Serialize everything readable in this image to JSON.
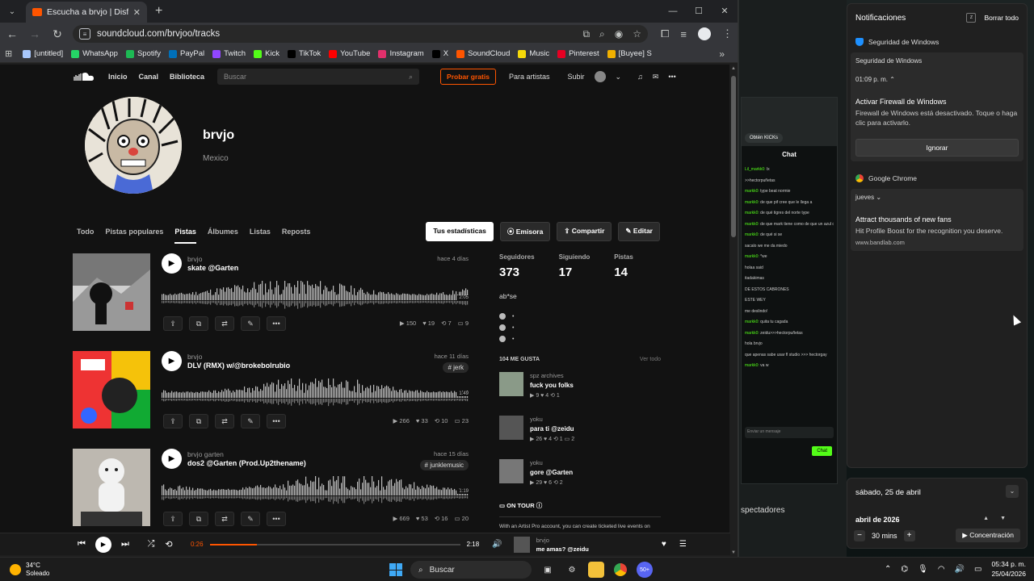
{
  "browser": {
    "tab_title": "Escucha a brvjo | Disfruta de álb",
    "url": "soundcloud.com/brvjoo/tracks",
    "bookmarks": [
      "[untitled]",
      "WhatsApp",
      "Spotify",
      "PayPal",
      "Twitch",
      "Kick",
      "TikTok",
      "YouTube",
      "Instagram",
      "X",
      "SoundCloud",
      "Music",
      "Pinterest",
      "[Buyee] S"
    ],
    "bookmark_colors": [
      "#a8c7fa",
      "#25d366",
      "#1db954",
      "#0070ba",
      "#9146ff",
      "#53fc18",
      "#000000",
      "#ff0000",
      "#e1306c",
      "#000000",
      "#ff5500",
      "#f5d90a",
      "#e60023",
      "#f0b000"
    ]
  },
  "sc": {
    "nav": [
      "Inicio",
      "Canal",
      "Biblioteca"
    ],
    "search_placeholder": "Buscar",
    "pro": "Probar gratis",
    "artists": "Para artistas",
    "upload": "Subir",
    "profile_name": "brvjo",
    "location": "Mexico",
    "tabs": [
      "Todo",
      "Pistas populares",
      "Pistas",
      "Álbumes",
      "Listas",
      "Reposts"
    ],
    "actions": {
      "stats": "Tus estadísticas",
      "station": "Emisora",
      "share": "Compartir",
      "edit": "Editar"
    },
    "tracks": [
      {
        "artist": "brvjo",
        "title": "skate @Garten",
        "date": "hace 4 días",
        "tag": "",
        "duration": "2:05",
        "plays": "150",
        "likes": "19",
        "reposts": "7",
        "comments": "9"
      },
      {
        "artist": "brvjo",
        "title": "DLV (RMX) w/@brokebolrubio",
        "date": "hace 11 días",
        "tag": "# jerk",
        "duration": "1:49",
        "plays": "266",
        "likes": "33",
        "reposts": "10",
        "comments": "23"
      },
      {
        "artist": "brvjo garten",
        "title": "dos2 @Garten (Prod.Up2thename)",
        "date": "hace 15 días",
        "tag": "# junklemusic",
        "duration": "1:19",
        "plays": "669",
        "likes": "53",
        "reposts": "16",
        "comments": "20"
      }
    ],
    "stats": {
      "followers_label": "Seguidores",
      "followers": "373",
      "following_label": "Siguiendo",
      "following": "17",
      "tracks_label": "Pistas",
      "tracks": "14"
    },
    "bio": "ab*se",
    "likes_header": "104 ME GUSTA",
    "see_all": "Ver todo",
    "likes": [
      {
        "artist": "spz archives",
        "title": "fuck you folks",
        "stats": "▶ 9  ♥ 4  ⟲ 1"
      },
      {
        "artist": "yoku",
        "title": "para ti @zeidu",
        "stats": "▶ 26  ♥ 4  ⟲ 1  ▭ 2"
      },
      {
        "artist": "yoku",
        "title": "gore @Garten",
        "stats": "▶ 29  ♥ 6  ⟲ 2"
      }
    ],
    "on_tour": "ON TOUR",
    "tour_text": "With an Artist Pro account, you can create ticketed live events on"
  },
  "player": {
    "current": "0:26",
    "total": "2:18",
    "progress_pct": 19,
    "artist": "brvjo",
    "title": "me amas? @zeidu"
  },
  "kick": {
    "obtain": "Obtén KICKs",
    "chat_title": "Chat",
    "messages": [
      {
        "n": "Lil_markk0:",
        "m": "lx"
      },
      {
        "n": "",
        "m": ">>hectorpuñetas"
      },
      {
        "n": "markk0:",
        "m": "type beat normie"
      },
      {
        "n": "markk0:",
        "m": "de que pif cree que le llega a"
      },
      {
        "n": "markk0:",
        "m": "de qué tigres del norte type"
      },
      {
        "n": "markk0:",
        "m": "de que mark tiene como de que un azul de thor we"
      },
      {
        "n": "markk0:",
        "m": "de qué si se"
      },
      {
        "n": "",
        "m": "sacalo we me da miedo"
      },
      {
        "n": "markk0:",
        "m": "*we"
      },
      {
        "n": "",
        "m": "holaa said"
      },
      {
        "n": "",
        "m": "itadakimas"
      },
      {
        "n": "",
        "m": "DE ESTOS CABRONES"
      },
      {
        "n": "",
        "m": "ESTE WEY"
      },
      {
        "n": "",
        "m": "me deslindo!"
      },
      {
        "n": "markk0:",
        "m": "quita tu cagada"
      },
      {
        "n": "markk0:",
        "m": "zeidu>>>hectorpuñetas"
      },
      {
        "n": "",
        "m": "hola brvjo"
      },
      {
        "n": "",
        "m": "que apenas sabe usar fl studio >>> hectorgay"
      },
      {
        "n": "markk0:",
        "m": "va w"
      }
    ],
    "input_placeholder": "Enviar un mensaje",
    "chat_btn": "Chat",
    "spectators": "spectadores",
    "footer_user": "Lil_markk0:",
    "footer_msg": "va w"
  },
  "notifications": {
    "title": "Notificaciones",
    "clear": "Borrar todo",
    "group1": "Seguridad de Windows",
    "card1_header": "Seguridad de Windows",
    "card1_time": "01:09 p. m.",
    "card1_title": "Activar Firewall de Windows",
    "card1_body": "Firewall de Windows está desactivado. Toque o haga clic para activarlo.",
    "card1_button": "Ignorar",
    "group2": "Google Chrome",
    "card2_day": "jueves",
    "card2_title": "Attract thousands of new fans",
    "card2_body": "Hit Profile Boost for the recognition you deserve.",
    "card2_url": "www.bandlab.com"
  },
  "calendar": {
    "date": "sábado, 25 de abril",
    "month": "abril de 2026",
    "focus_time": "30 mins",
    "focus_btn": "Concentración"
  },
  "taskbar": {
    "temp": "34°C",
    "weather": "Soleado",
    "search": "Buscar",
    "time": "05:34 p. m.",
    "date": "25/04/2026",
    "badge": "50+"
  }
}
